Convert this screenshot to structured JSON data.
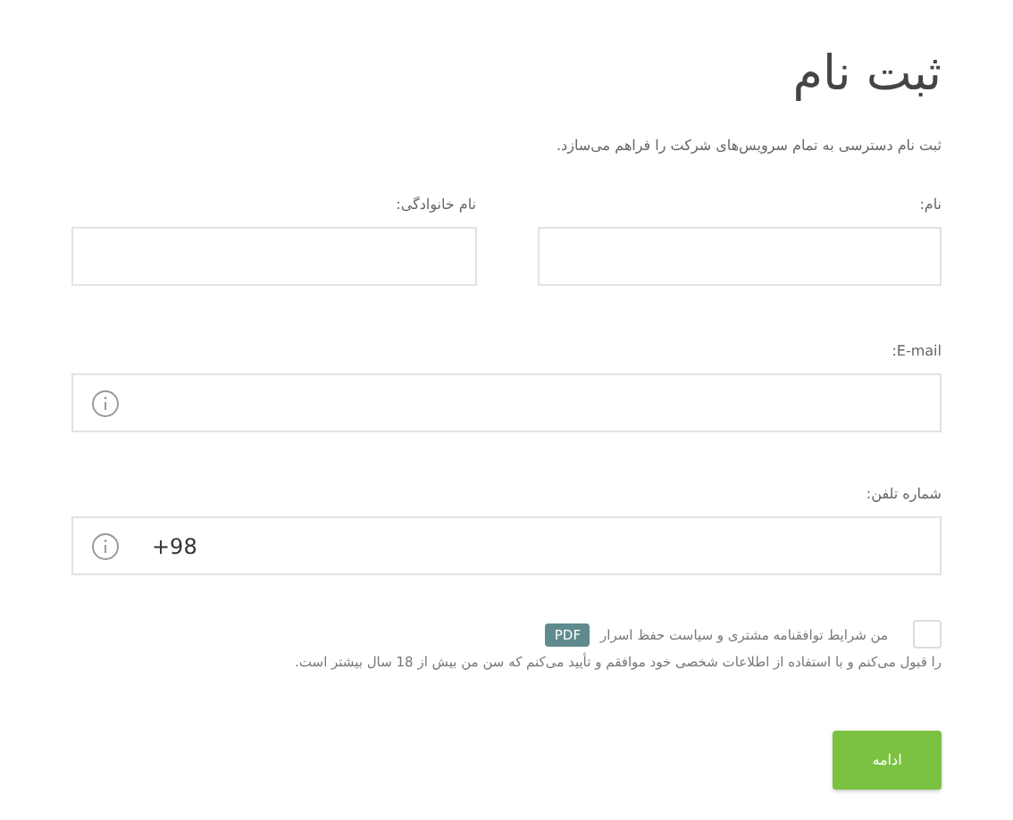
{
  "title": "ثبت نام",
  "subtitle": "ثبت نام دسترسی به تمام سرویس‌های شرکت را فراهم می‌سازد.",
  "name_fields": [
    {
      "label": "نام:"
    },
    {
      "label": "نام خانوادگی:"
    }
  ],
  "email": {
    "label": "E-mail:"
  },
  "phone": {
    "label": "شماره تلفن:",
    "value": "+98"
  },
  "consent": {
    "checked": false,
    "text_before": "من شرایط توافقنامه مشتری و سیاست حفظ اسرار",
    "pdf_label": "PDF",
    "text_after": "را قبول می‌کنم و با استفاده از اطلاعات شخصی خود موافقم و تأیید می‌کنم که سن من بیش از 18 سال بیشتر است."
  },
  "submit": "ادامه"
}
